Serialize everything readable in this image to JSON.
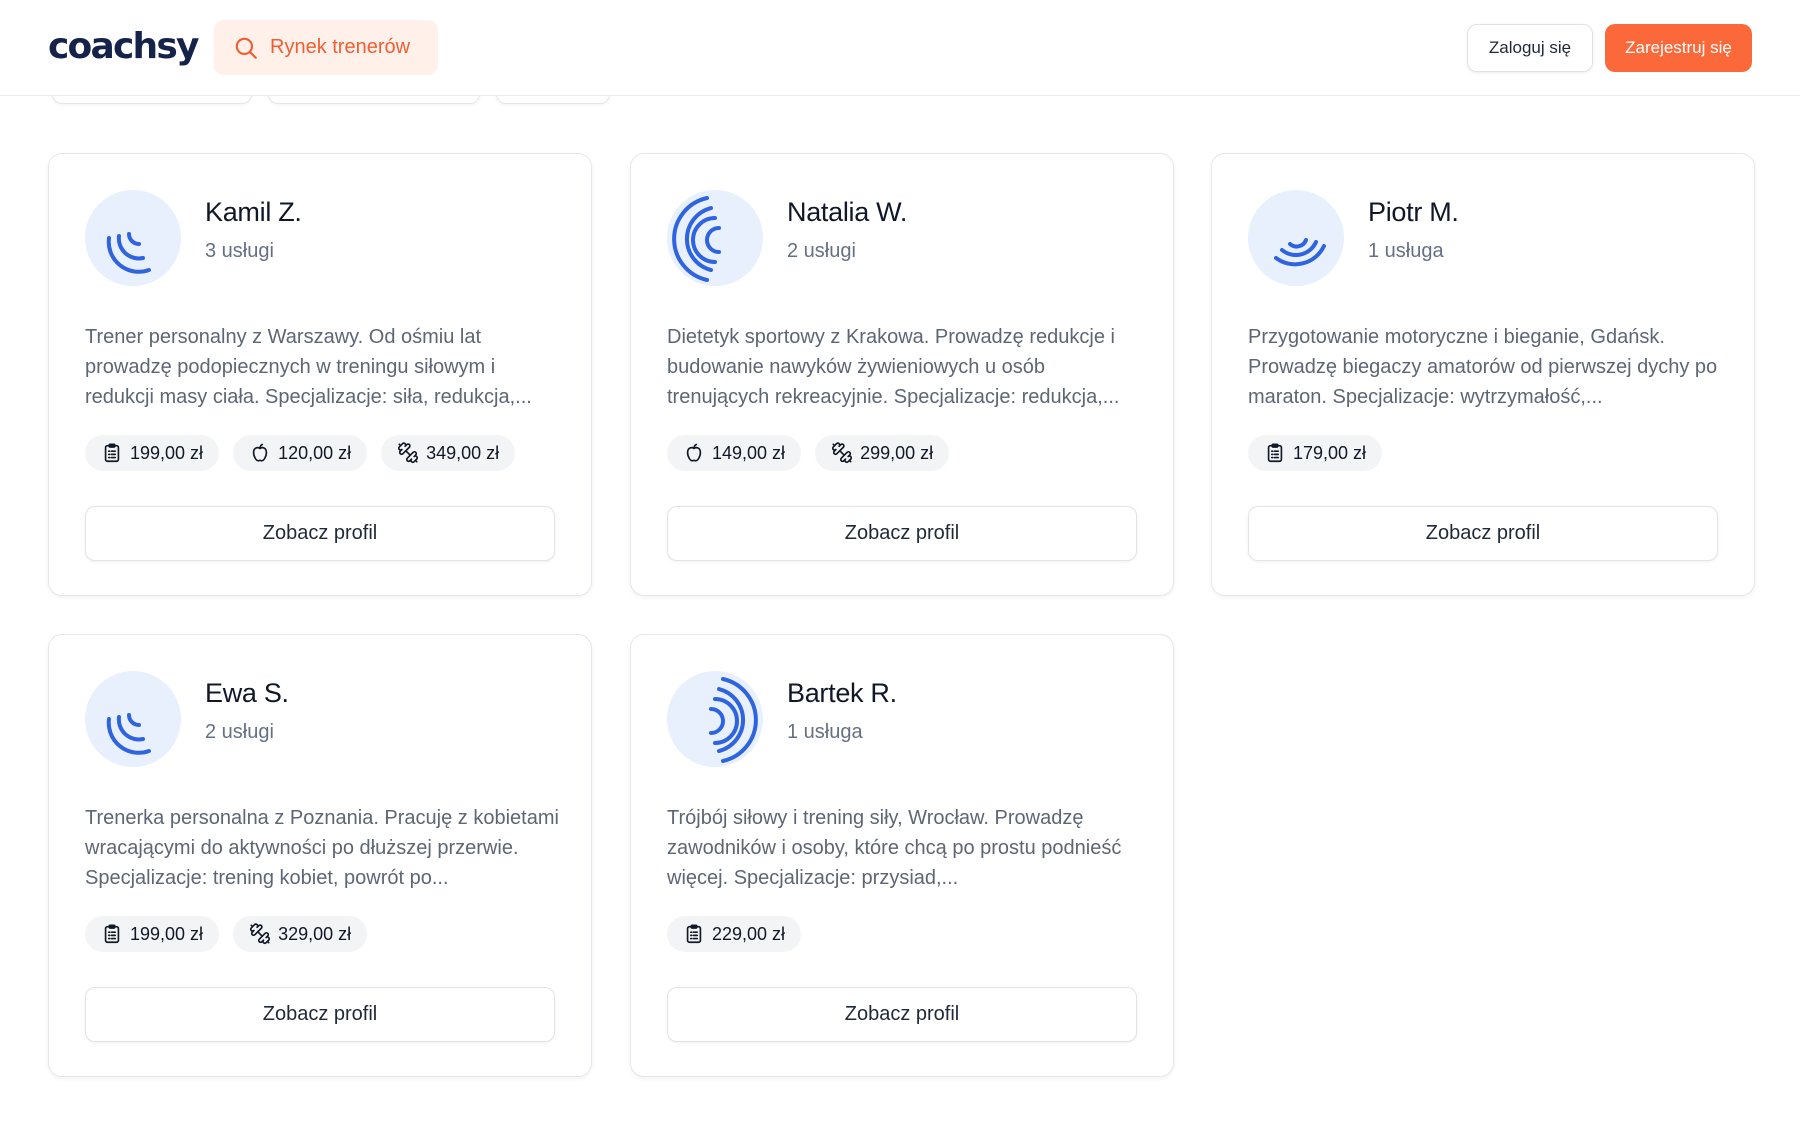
{
  "brand": {
    "logo_text": "coachsy"
  },
  "header": {
    "market_label": "Rynek trenerów",
    "market_icon": "search-icon",
    "login_label": "Zaloguj się",
    "register_label": "Zarejestruj się"
  },
  "colors": {
    "accent": "#fb6839",
    "accent_light": "#fff0e9",
    "avatar_bg": "#e8f0fd",
    "avatar_stroke": "#2f64e0",
    "text_primary": "#101828",
    "text_muted": "#667085"
  },
  "cards": [
    {
      "name": "Kamil Z.",
      "services": "3 usługi",
      "avatar_icon": "arcs-bottom-left-icon",
      "description": "Trener personalny z Warszawy. Od ośmiu lat prowadzę podopiecznych w treningu siłowym i redukcji masy ciała. Specjalizacje: siła, redukcja,...",
      "prices": [
        {
          "icon": "clipboard-icon",
          "value": "199,00 zł"
        },
        {
          "icon": "apple-icon",
          "value": "120,00 zł"
        },
        {
          "icon": "dumbbell-icon",
          "value": "349,00 zł"
        }
      ],
      "button_label": "Zobacz profil"
    },
    {
      "name": "Natalia W.",
      "services": "2 usługi",
      "avatar_icon": "arcs-left-icon",
      "description": "Dietetyk sportowy z Krakowa. Prowadzę redukcje i budowanie nawyków żywieniowych u osób trenujących rekreacyjnie. Specjalizacje: redukcja,...",
      "prices": [
        {
          "icon": "apple-icon",
          "value": "149,00 zł"
        },
        {
          "icon": "dumbbell-icon",
          "value": "299,00 zł"
        }
      ],
      "button_label": "Zobacz profil"
    },
    {
      "name": "Piotr M.",
      "services": "1 usługa",
      "avatar_icon": "arcs-bottom-right-icon",
      "description": "Przygotowanie motoryczne i bieganie, Gdańsk. Prowadzę biegaczy amatorów od pierwszej dychy po maraton. Specjalizacje: wytrzymałość,...",
      "prices": [
        {
          "icon": "clipboard-icon",
          "value": "179,00 zł"
        }
      ],
      "button_label": "Zobacz profil"
    },
    {
      "name": "Ewa S.",
      "services": "2 usługi",
      "avatar_icon": "arcs-bottom-left-icon",
      "description": "Trenerka personalna z Poznania. Pracuję z kobietami wracającymi do aktywności po dłuższej przerwie. Specjalizacje: trening kobiet, powrót po...",
      "prices": [
        {
          "icon": "clipboard-icon",
          "value": "199,00 zł"
        },
        {
          "icon": "dumbbell-icon",
          "value": "329,00 zł"
        }
      ],
      "button_label": "Zobacz profil"
    },
    {
      "name": "Bartek R.",
      "services": "1 usługa",
      "avatar_icon": "arcs-right-icon",
      "description": "Trójbój siłowy i trening siły, Wrocław. Prowadzę zawodników i osoby, które chcą po prostu podnieść więcej. Specjalizacje: przysiad,...",
      "prices": [
        {
          "icon": "clipboard-icon",
          "value": "229,00 zł"
        }
      ],
      "button_label": "Zobacz profil"
    }
  ]
}
